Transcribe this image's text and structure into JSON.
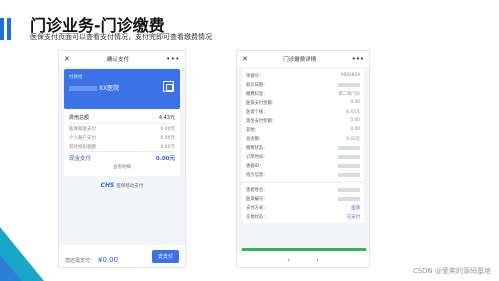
{
  "slide": {
    "title": "门诊业务-门诊缴费",
    "subtitle": "医保支付页面可以查看支付情况，支付完即可查看缴费情况",
    "watermark": "CSDN @爱笑的源码基地"
  },
  "colors": {
    "accent": "#1f6fe0",
    "primary": "#3b73e6",
    "teal": "#17a7c9",
    "success": "#2fb35a"
  },
  "phone1": {
    "nav_title": "确认支付",
    "close_icon": "close-icon",
    "more_icon": "more-icon",
    "header_label": "付款给",
    "hospital": "XX医院",
    "rows": [
      {
        "label": "费用总额",
        "value": "4.43元"
      },
      {
        "label": "医保基金支付",
        "value": "0.00元"
      },
      {
        "label": "个人账户支付",
        "value": "0.00元"
      },
      {
        "label": "其他抵扣金额",
        "value": "0.00元"
      }
    ],
    "cash_label": "现金支付",
    "cash_value": "0.00元",
    "more_link": "查看明细",
    "logo_text": "CHS",
    "logo_sub": "医保移动支付",
    "bottom_label": "您还需支付：",
    "bottom_amount": "¥0.00",
    "pay_button": "去支付"
  },
  "phone2": {
    "nav_title": "门诊缴费详情",
    "rows_a": [
      {
        "label": "单据号：",
        "value": "9602839"
      },
      {
        "label": "就诊日期：",
        "value": ""
      },
      {
        "label": "缴费科室：",
        "value": "第二科门诊"
      },
      {
        "label": "医保支付金额：",
        "value": "0.00"
      },
      {
        "label": "医保个账：",
        "value": "4.43元"
      },
      {
        "label": "现金支付金额：",
        "value": "0.00"
      },
      {
        "label": "其他：",
        "value": "0.00"
      },
      {
        "label": "总金额：",
        "value": "4.43元"
      },
      {
        "label": "缴费状态：",
        "value": ""
      },
      {
        "label": "订单时间：",
        "value": ""
      },
      {
        "label": "收据ID：",
        "value": ""
      },
      {
        "label": "指引信息：",
        "value": ""
      }
    ],
    "rows_b": [
      {
        "label": "患者姓名：",
        "value": ""
      },
      {
        "label": "医保编号：",
        "value": ""
      },
      {
        "label": "支付方式：",
        "value": "医保"
      },
      {
        "label": "交易状态：",
        "value": "已支付"
      }
    ],
    "back_icon": "chevron-left-icon",
    "forward_icon": "chevron-right-icon"
  }
}
